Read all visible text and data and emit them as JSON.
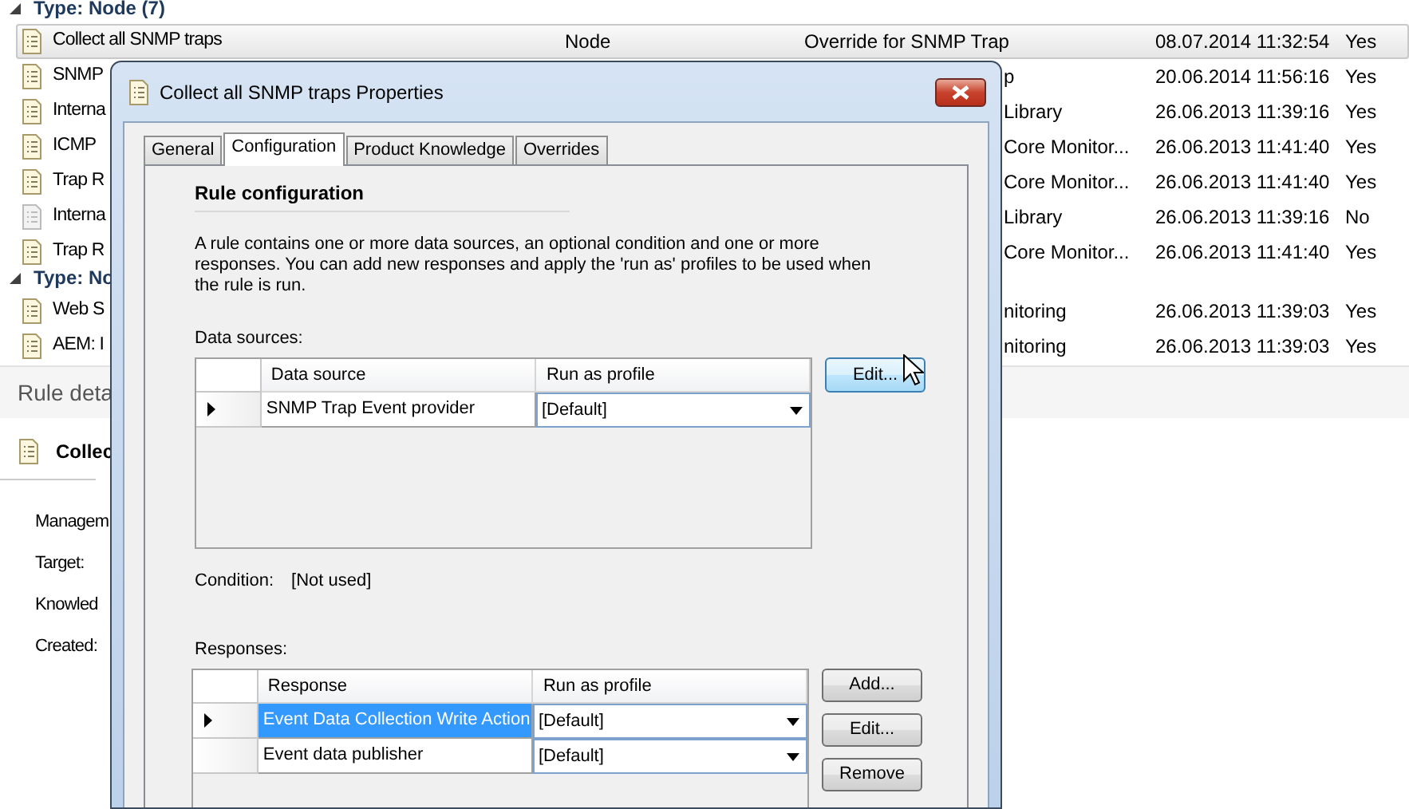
{
  "list": {
    "groups": [
      {
        "header": "Type: Node (7)",
        "expanded": true,
        "rows": [
          {
            "name": "Collect all SNMP traps",
            "target": "Node",
            "management_pack": "Override for SNMP Trap",
            "created": "08.07.2014 11:32:54",
            "enabled": "Yes",
            "selected": true,
            "disabled": false,
            "covered": false
          },
          {
            "name": "SNMP",
            "management_pack": "p",
            "created": "20.06.2014 11:56:16",
            "enabled": "Yes",
            "selected": false,
            "disabled": false,
            "covered": true
          },
          {
            "name": "Interna",
            "management_pack": "Library",
            "created": "26.06.2013 11:39:16",
            "enabled": "Yes",
            "selected": false,
            "disabled": false,
            "covered": true
          },
          {
            "name": "ICMP",
            "management_pack": "Core Monitor...",
            "created": "26.06.2013 11:41:40",
            "enabled": "Yes",
            "selected": false,
            "disabled": false,
            "covered": true
          },
          {
            "name": "Trap R",
            "management_pack": "Core Monitor...",
            "created": "26.06.2013 11:41:40",
            "enabled": "Yes",
            "selected": false,
            "disabled": false,
            "covered": true
          },
          {
            "name": "Interna",
            "management_pack": "Library",
            "created": "26.06.2013 11:39:16",
            "enabled": "No",
            "selected": false,
            "disabled": true,
            "covered": true
          },
          {
            "name": "Trap R",
            "management_pack": "Core Monitor...",
            "created": "26.06.2013 11:41:40",
            "enabled": "Yes",
            "selected": false,
            "disabled": false,
            "covered": true
          }
        ]
      },
      {
        "header": "Type: No",
        "expanded": true,
        "rows": [
          {
            "name": "Web S",
            "management_pack": "nitoring",
            "created": "26.06.2013 11:39:03",
            "enabled": "Yes",
            "selected": false,
            "disabled": false,
            "covered": true
          },
          {
            "name": "AEM: I",
            "management_pack": "nitoring",
            "created": "26.06.2013 11:39:03",
            "enabled": "Yes",
            "selected": false,
            "disabled": false,
            "covered": true
          }
        ]
      }
    ]
  },
  "details": {
    "title": "Rule deta",
    "rule_name": "Collec",
    "fields": [
      "Managem",
      "Target:",
      "Knowled",
      "Created:"
    ]
  },
  "dialog": {
    "title": "Collect all SNMP traps Properties",
    "tabs": [
      {
        "label": "General",
        "selected": false
      },
      {
        "label": "Configuration",
        "selected": true
      },
      {
        "label": "Product Knowledge",
        "selected": false
      },
      {
        "label": "Overrides",
        "selected": false
      }
    ],
    "heading": "Rule configuration",
    "description": "A rule contains one or more data sources, an optional condition and one or more responses. You can add new responses and apply the 'run as' profiles to be used when the rule is run.",
    "data_sources": {
      "label": "Data sources:",
      "columns": [
        "Data source",
        "Run as profile"
      ],
      "rows": [
        {
          "name": "SNMP Trap Event provider",
          "profile": "[Default]",
          "current": true,
          "selected": false
        }
      ],
      "buttons": [
        "Edit..."
      ]
    },
    "condition": {
      "label": "Condition:",
      "value": "[Not used]"
    },
    "responses": {
      "label": "Responses:",
      "columns": [
        "Response",
        "Run as profile"
      ],
      "rows": [
        {
          "name": "Event Data Collection Write Action",
          "profile": "[Default]",
          "current": true,
          "selected": true
        },
        {
          "name": "Event data publisher",
          "profile": "[Default]",
          "current": false,
          "selected": false
        }
      ],
      "buttons": [
        "Add...",
        "Edit...",
        "Remove"
      ]
    }
  }
}
